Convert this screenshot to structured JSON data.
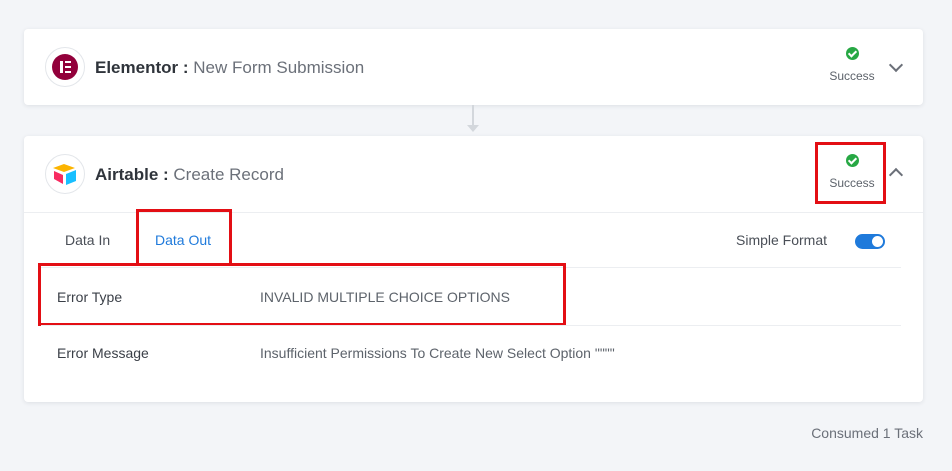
{
  "steps": [
    {
      "app": "Elementor",
      "separator": " : ",
      "event": "New Form Submission",
      "status": "Success",
      "logo_color": "#92003b"
    },
    {
      "app": "Airtable",
      "separator": " : ",
      "event": "Create Record",
      "status": "Success",
      "tabs": [
        {
          "label": "Data In",
          "active": false
        },
        {
          "label": "Data Out",
          "active": true
        }
      ],
      "simple_format": {
        "label": "Simple Format",
        "enabled": true
      },
      "rows": [
        {
          "key": "Error Type",
          "value": "INVALID MULTIPLE CHOICE OPTIONS"
        },
        {
          "key": "Error Message",
          "value": "Insufficient Permissions To Create New Select Option \"\"\"\""
        }
      ]
    }
  ],
  "footer": {
    "consumed": "Consumed 1 Task"
  },
  "colors": {
    "accent": "#1f7adb",
    "success": "#27a844",
    "highlight": "#e30e14"
  }
}
